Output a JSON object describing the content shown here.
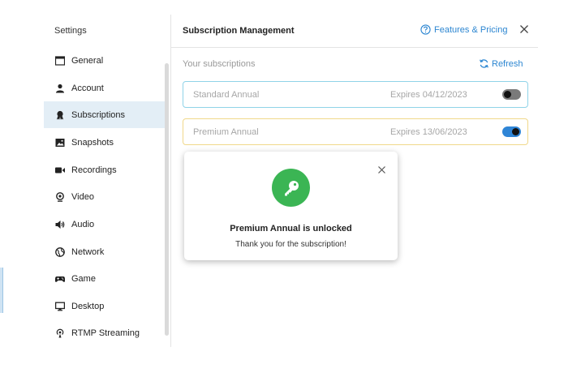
{
  "sidebar": {
    "title": "Settings",
    "items": [
      {
        "label": "General",
        "icon": "window-icon"
      },
      {
        "label": "Account",
        "icon": "user-icon"
      },
      {
        "label": "Subscriptions",
        "icon": "badge-icon",
        "active": true
      },
      {
        "label": "Snapshots",
        "icon": "image-icon"
      },
      {
        "label": "Recordings",
        "icon": "video-camera-icon"
      },
      {
        "label": "Video",
        "icon": "webcam-icon"
      },
      {
        "label": "Audio",
        "icon": "speaker-icon"
      },
      {
        "label": "Network",
        "icon": "globe-icon"
      },
      {
        "label": "Game",
        "icon": "gamepad-icon"
      },
      {
        "label": "Desktop",
        "icon": "monitor-icon"
      },
      {
        "label": "RTMP Streaming",
        "icon": "broadcast-icon"
      }
    ]
  },
  "header": {
    "title": "Subscription Management",
    "features_link": "Features & Pricing"
  },
  "subscriptions": {
    "section_label": "Your subscriptions",
    "refresh_label": "Refresh",
    "items": [
      {
        "name": "Standard Annual",
        "expiry": "Expires 04/12/2023",
        "enabled": false
      },
      {
        "name": "Premium Annual",
        "expiry": "Expires 13/06/2023",
        "enabled": true
      }
    ]
  },
  "popup": {
    "title": "Premium Annual is unlocked",
    "message": "Thank you for the subscription!"
  },
  "colors": {
    "accent": "#2c86d1",
    "active_nav": "#e3eef6",
    "success": "#3bb554",
    "standard_border": "#8fd3e8",
    "premium_border": "#f0d88a"
  }
}
